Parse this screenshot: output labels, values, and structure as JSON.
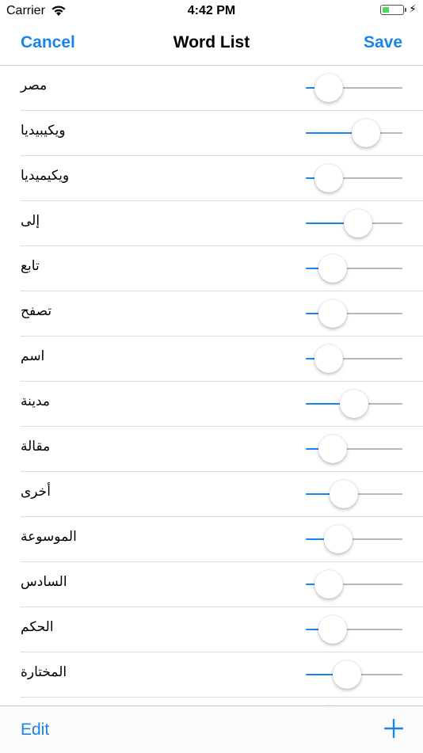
{
  "status_bar": {
    "carrier": "Carrier",
    "time": "4:42 PM",
    "battery_level": 0.35,
    "charging": true
  },
  "nav": {
    "cancel_label": "Cancel",
    "title": "Word List",
    "save_label": "Save"
  },
  "colors": {
    "accent": "#1a85e8",
    "battery": "#4cd964"
  },
  "words": [
    {
      "word": "مصر",
      "value": 0.24
    },
    {
      "word": "ويكيبيديا",
      "value": 0.62
    },
    {
      "word": "ويكيميديا",
      "value": 0.24
    },
    {
      "word": "إلى",
      "value": 0.54
    },
    {
      "word": "تابع",
      "value": 0.28
    },
    {
      "word": "تصفح",
      "value": 0.28
    },
    {
      "word": "اسم",
      "value": 0.24
    },
    {
      "word": "مدينة",
      "value": 0.5
    },
    {
      "word": "مقالة",
      "value": 0.28
    },
    {
      "word": "أخرى",
      "value": 0.39
    },
    {
      "word": "الموسوعة",
      "value": 0.34
    },
    {
      "word": "السادس",
      "value": 0.24
    },
    {
      "word": "الحكم",
      "value": 0.28
    },
    {
      "word": "المختارة",
      "value": 0.43
    },
    {
      "word": "",
      "value": 0.24
    }
  ],
  "toolbar": {
    "edit_label": "Edit",
    "add_icon": "plus-icon"
  }
}
